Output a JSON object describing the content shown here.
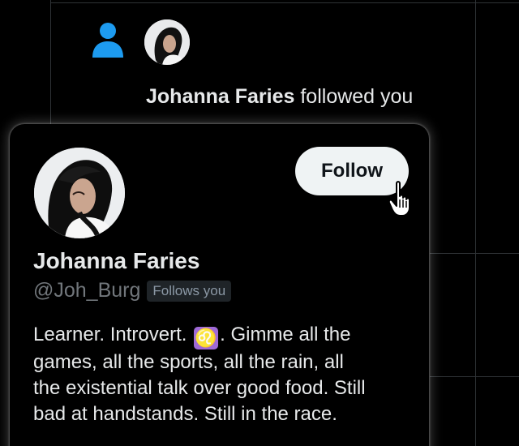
{
  "notification": {
    "icon": "person-icon",
    "name": "Johanna Faries",
    "action_text": "followed you"
  },
  "profile_card": {
    "display_name": "Johanna Faries",
    "handle": "@Joh_Burg",
    "follows_you_badge": "Follows you",
    "follow_button_label": "Follow",
    "bio_lines": [
      {
        "text": "Learner. Introvert. ",
        "emoji": "♌",
        "after": ". Gimme all the"
      },
      {
        "text": "games, all the sports, all the rain, all"
      },
      {
        "text": "the existential talk over good food. Still"
      },
      {
        "text": "bad at handstands. Still in the race."
      }
    ]
  },
  "colors": {
    "background": "#000000",
    "accent_blue": "#1d9bf0",
    "text_primary": "#e7e9ea",
    "text_secondary": "#71767b",
    "button_bg": "#eff3f4",
    "emoji_purple": "#9f6ad6"
  }
}
